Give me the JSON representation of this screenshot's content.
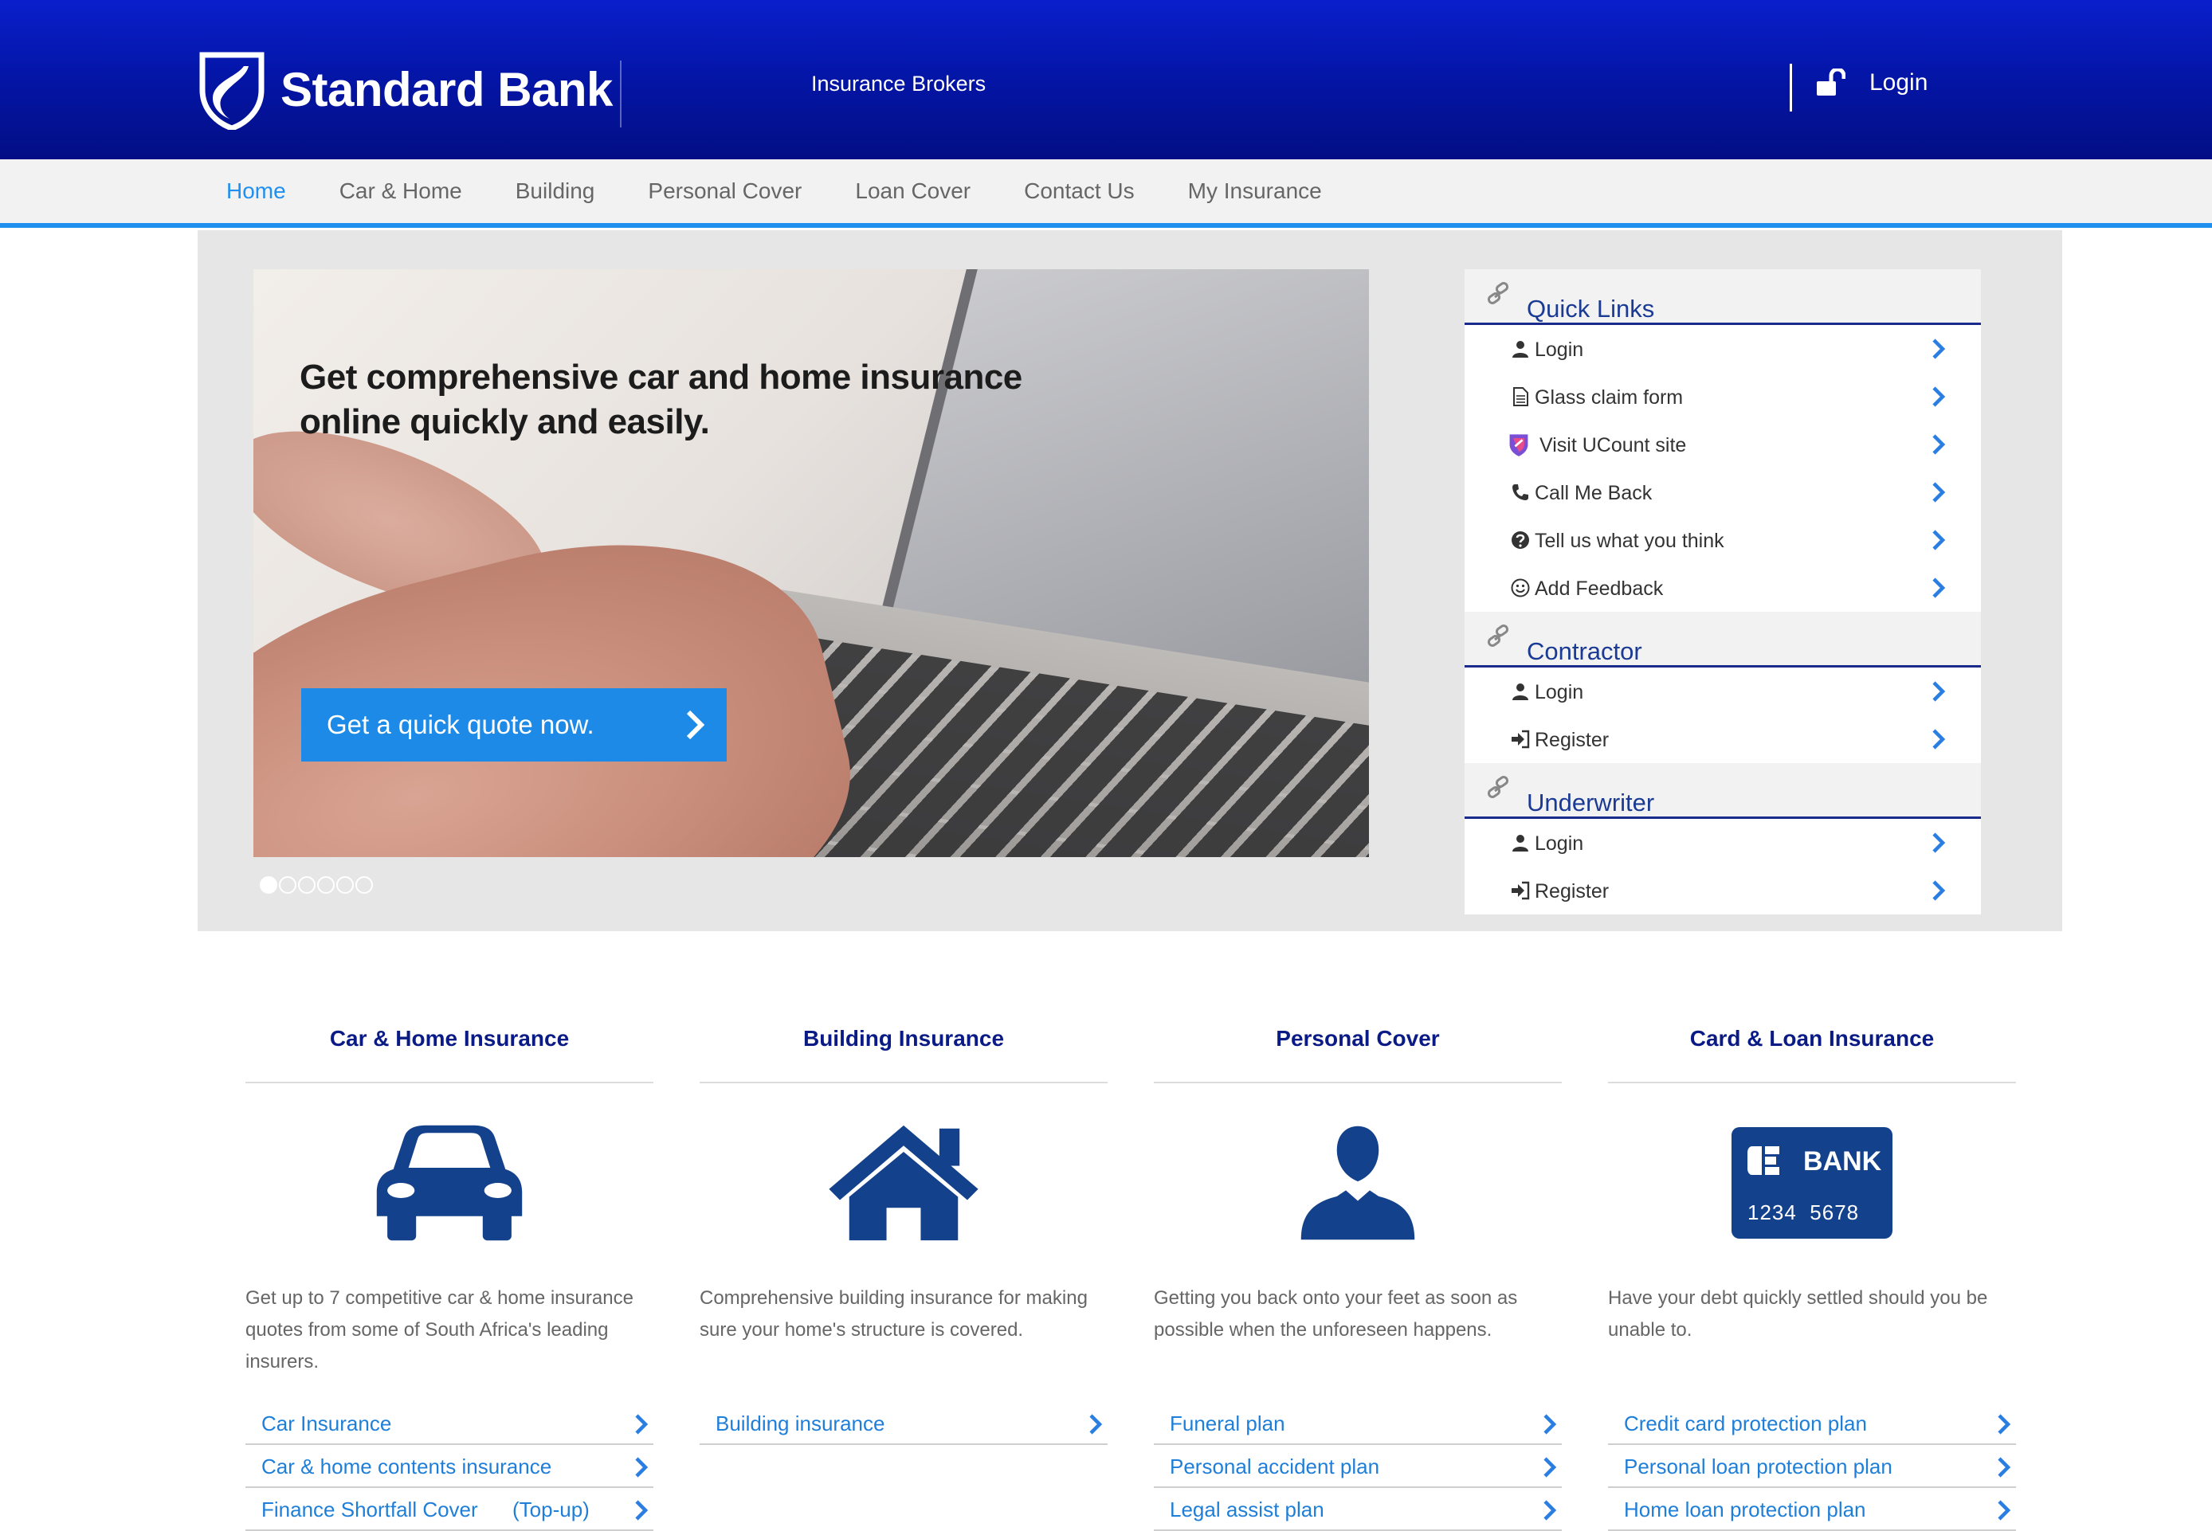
{
  "header": {
    "brand": "Standard Bank",
    "subtitle": "Insurance Brokers",
    "login_label": "Login"
  },
  "nav": {
    "items": [
      {
        "label": "Home",
        "active": true
      },
      {
        "label": "Car & Home",
        "active": false
      },
      {
        "label": "Building",
        "active": false
      },
      {
        "label": "Personal Cover",
        "active": false
      },
      {
        "label": "Loan Cover",
        "active": false
      },
      {
        "label": "Contact Us",
        "active": false
      },
      {
        "label": "My Insurance",
        "active": false
      }
    ]
  },
  "banner": {
    "headline_line1": "Get comprehensive car and home insurance",
    "headline_line2": "online quickly and easily.",
    "cta_label": "Get a quick quote now.",
    "slide_count": 6,
    "active_slide": 1
  },
  "quick_links": {
    "title": "Quick Links",
    "items": [
      {
        "label": "Login",
        "icon": "user-icon"
      },
      {
        "label": "Glass claim form",
        "icon": "document-icon"
      },
      {
        "label": "Visit UCount site",
        "icon": "ucount-logo-icon"
      },
      {
        "label": "Call Me Back",
        "icon": "phone-icon"
      },
      {
        "label": "Tell us what you think",
        "icon": "question-circle-icon"
      },
      {
        "label": "Add Feedback",
        "icon": "smiley-icon"
      }
    ]
  },
  "contractor": {
    "title": "Contractor",
    "items": [
      {
        "label": "Login",
        "icon": "user-icon"
      },
      {
        "label": "Register",
        "icon": "sign-in-icon"
      }
    ]
  },
  "underwriter": {
    "title": "Underwriter",
    "items": [
      {
        "label": "Login",
        "icon": "user-icon"
      },
      {
        "label": "Register",
        "icon": "sign-in-icon"
      }
    ]
  },
  "products": [
    {
      "title": "Car & Home Insurance",
      "icon": "car-icon",
      "description": "Get up to 7 competitive car & home insurance quotes from some of South Africa's leading insurers.",
      "links": [
        "Car Insurance",
        "Car & home contents insurance",
        "Finance Shortfall Cover      (Top-up)"
      ]
    },
    {
      "title": "Building Insurance",
      "icon": "house-icon",
      "description": "Comprehensive building insurance for making sure your home's structure is covered.",
      "links": [
        "Building insurance"
      ]
    },
    {
      "title": "Personal Cover",
      "icon": "person-icon",
      "description": "Getting you back onto your feet as soon as possible when the unforeseen happens.",
      "links": [
        "Funeral plan",
        "Personal accident plan",
        "Legal assist plan"
      ]
    },
    {
      "title": "Card & Loan Insurance",
      "icon": "bank-card-icon",
      "description": "Have your debt quickly settled should you be unable to.",
      "links": [
        "Credit card protection plan",
        "Personal loan protection plan",
        "Home loan protection plan"
      ],
      "card_text": "BANK",
      "card_number": "1234  5678"
    }
  ],
  "colors": {
    "header_blue": "#0416a9",
    "accent_blue": "#1f8ff0",
    "title_navy": "#0b1b86",
    "link_blue": "#1f7fd8",
    "icon_navy": "#14418c"
  }
}
